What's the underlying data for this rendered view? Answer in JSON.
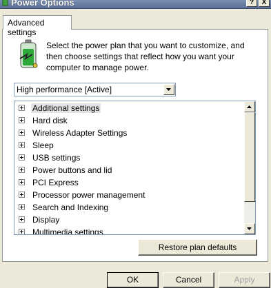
{
  "window": {
    "title": "Power Options",
    "help_label": "?",
    "close_label": "X"
  },
  "tab": {
    "label": "Advanced settings"
  },
  "description": "Select the power plan that you want to customize, and then choose settings that reflect how you want your computer to manage power.",
  "plan_select": {
    "value": "High performance [Active]"
  },
  "tree": {
    "items": [
      {
        "label": "Additional settings",
        "selected": true
      },
      {
        "label": "Hard disk"
      },
      {
        "label": "Wireless Adapter Settings"
      },
      {
        "label": "Sleep"
      },
      {
        "label": "USB settings"
      },
      {
        "label": "Power buttons and lid"
      },
      {
        "label": "PCI Express"
      },
      {
        "label": "Processor power management"
      },
      {
        "label": "Search and Indexing"
      },
      {
        "label": "Display"
      },
      {
        "label": "Multimedia settings"
      }
    ]
  },
  "buttons": {
    "restore": "Restore plan defaults",
    "ok": "OK",
    "cancel": "Cancel",
    "apply": "Apply"
  },
  "colors": {
    "dialog_bg": "#ece9d8",
    "border": "#7f9db9",
    "disabled_text": "#a0a0a0"
  }
}
